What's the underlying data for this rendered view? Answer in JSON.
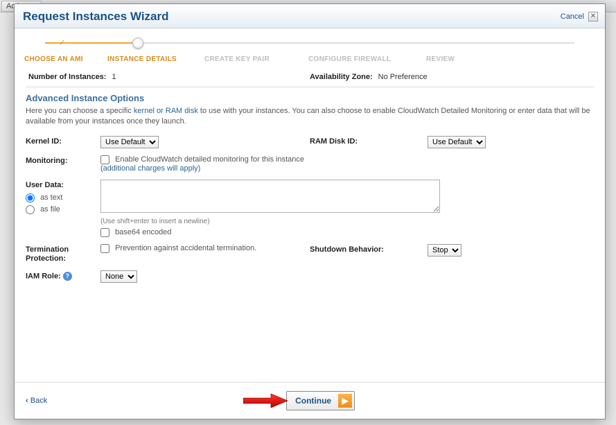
{
  "bg": {
    "actions_label": "Actions"
  },
  "modal": {
    "title": "Request Instances Wizard",
    "cancel": "Cancel"
  },
  "steps": {
    "s1": "CHOOSE AN AMI",
    "s2": "INSTANCE DETAILS",
    "s3": "CREATE KEY PAIR",
    "s4": "CONFIGURE FIREWALL",
    "s5": "REVIEW"
  },
  "summary": {
    "num_label": "Number of Instances:",
    "num_value": "1",
    "az_label": "Availability Zone:",
    "az_value": "No Preference"
  },
  "section": {
    "title": "Advanced Instance Options",
    "desc_pre": "Here you can choose a specific ",
    "desc_link": "kernel or RAM disk",
    "desc_post": " to use with your instances. You can also choose to enable CloudWatch Detailed Monitoring or enter data that will be available from your instances once they launch."
  },
  "form": {
    "kernel_label": "Kernel ID:",
    "kernel_value": "Use Default",
    "ramdisk_label": "RAM Disk ID:",
    "ramdisk_value": "Use Default",
    "monitoring_label": "Monitoring:",
    "monitoring_check": "Enable CloudWatch detailed monitoring for this instance",
    "monitoring_charges": "(additional charges will apply)",
    "userdata_label": "User Data:",
    "userdata_as_text": "as text",
    "userdata_as_file": "as file",
    "userdata_hint": "(Use shift+enter to insert a newline)",
    "userdata_base64": "base64 encoded",
    "termination_label": "Termination Protection:",
    "termination_check": "Prevention against accidental termination.",
    "shutdown_label": "Shutdown Behavior:",
    "shutdown_value": "Stop",
    "iam_label": "IAM Role:",
    "iam_value": "None"
  },
  "footer": {
    "back": "Back",
    "continue": "Continue"
  }
}
